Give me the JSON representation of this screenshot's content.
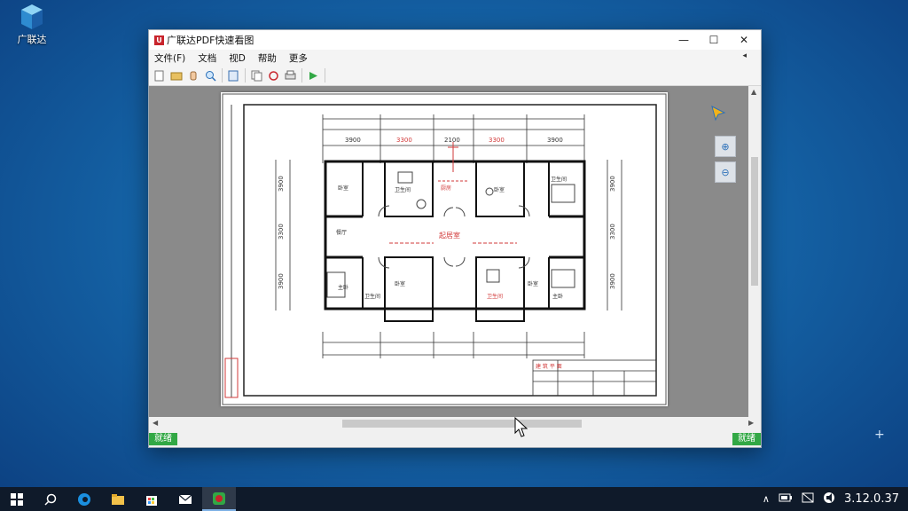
{
  "desktop": {
    "icon_label": "广联达",
    "plus_glyph": "+"
  },
  "window": {
    "title": "广联达PDF快速看图",
    "logo_glyph": "U",
    "controls": {
      "minimize": "—",
      "maximize": "☐",
      "close": "✕"
    },
    "menus": [
      "文件(F)",
      "文档",
      "视D",
      "帮助",
      "更多"
    ],
    "menu_overflow": "◂",
    "status_left": "就绪",
    "status_right": "就绪"
  },
  "drawing": {
    "center_label": "起居室",
    "room_labels": [
      "卧室",
      "卫生间",
      "厨房",
      "卧室",
      "卫生间",
      "餐厅",
      "主卧",
      "卧室",
      "卫生间",
      "卫生间",
      "卧室",
      "主卧"
    ],
    "dims_top": [
      "3900",
      "3300",
      "2100",
      "3300",
      "3900"
    ],
    "dims_left": [
      "3900",
      "3300",
      "3900"
    ],
    "dims_right": [
      "3900",
      "3300",
      "3900"
    ],
    "title_block_top": "建 筑 平 面"
  },
  "taskbar": {
    "start": "⊞",
    "search": "⌕",
    "tray_up": "∧",
    "clock": "3.12.0.37"
  },
  "colors": {
    "accent_green": "#32a845",
    "drawing_red": "#d23a3a",
    "app_red": "#c8242c"
  }
}
